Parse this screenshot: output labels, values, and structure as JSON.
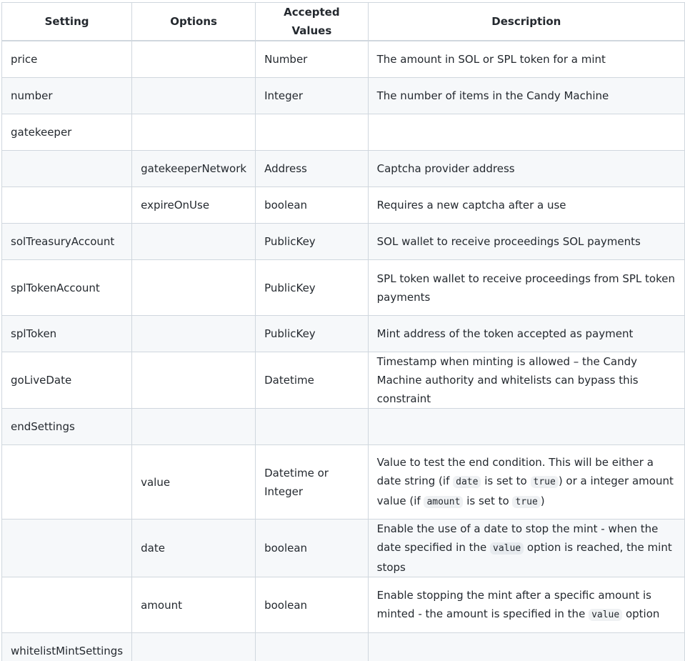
{
  "table": {
    "headers": {
      "setting": "Setting",
      "options": "Options",
      "accepted": "Accepted Values",
      "description": "Description"
    },
    "rows": [
      {
        "setting": "price",
        "option": "",
        "accepted": "Number",
        "description": "The amount in SOL or SPL token for a mint"
      },
      {
        "setting": "number",
        "option": "",
        "accepted": "Integer",
        "description": "The number of items in the Candy Machine"
      },
      {
        "setting": "gatekeeper",
        "option": "",
        "accepted": "",
        "description": ""
      },
      {
        "setting": "",
        "option": "gatekeeperNetwork",
        "accepted": "Address",
        "description": "Captcha provider address"
      },
      {
        "setting": "",
        "option": "expireOnUse",
        "accepted": "boolean",
        "description": "Requires a new captcha after a use"
      },
      {
        "setting": "solTreasuryAccount",
        "option": "",
        "accepted": "PublicKey",
        "description": "SOL wallet to receive proceedings SOL payments"
      },
      {
        "setting": "splTokenAccount",
        "option": "",
        "accepted": "PublicKey",
        "description": "SPL token wallet to receive proceedings from SPL token payments"
      },
      {
        "setting": "splToken",
        "option": "",
        "accepted": "PublicKey",
        "description": "Mint address of the token accepted as payment"
      },
      {
        "setting": "goLiveDate",
        "option": "",
        "accepted": "Datetime",
        "description": "Timestamp when minting is allowed – the Candy Machine authority and whitelists can bypass this constraint"
      },
      {
        "setting": "endSettings",
        "option": "",
        "accepted": "",
        "description": ""
      },
      {
        "setting": "",
        "option": "value",
        "accepted": "Datetime or Integer",
        "desc_parts": {
          "p1": "Value to test the end condition. This will be either a date string (if ",
          "c1": "date",
          "p2": " is set to ",
          "c2": "true",
          "p3": ") or a integer amount value (if ",
          "c3": "amount",
          "p4": " is set to ",
          "c4": "true",
          "p5": ")"
        }
      },
      {
        "setting": "",
        "option": "date",
        "accepted": "boolean",
        "desc_parts": {
          "p1": "Enable the use of a date to stop the mint - when the date specified in the ",
          "c1": "value",
          "p2": " option is reached, the mint stops"
        }
      },
      {
        "setting": "",
        "option": "amount",
        "accepted": "boolean",
        "desc_parts": {
          "p1": "Enable stopping the mint after a specific amount is minted - the amount is specified in the ",
          "c1": "value",
          "p2": " option"
        }
      },
      {
        "setting": "whitelistMintSettings",
        "option": "",
        "accepted": "",
        "description": ""
      }
    ]
  }
}
